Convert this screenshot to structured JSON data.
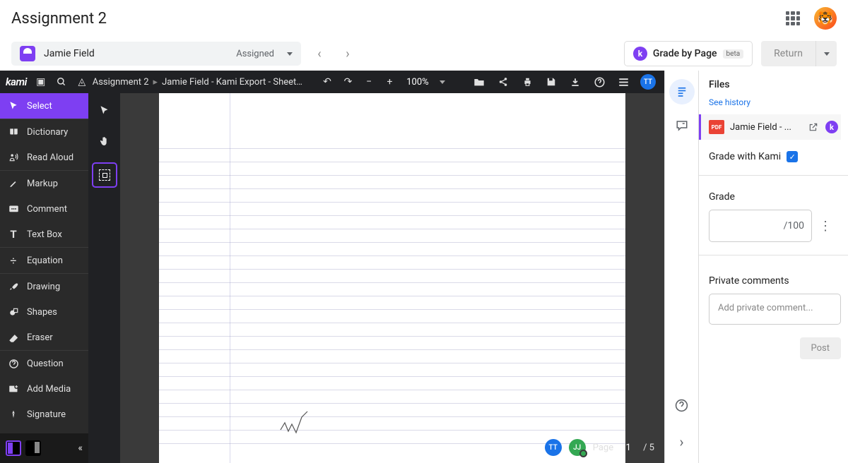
{
  "header": {
    "title": "Assignment 2"
  },
  "student": {
    "name": "Jamie Field",
    "status": "Assigned"
  },
  "actions": {
    "grade_by_page": "Grade by Page",
    "beta": "beta",
    "return": "Return"
  },
  "kami": {
    "logo": "kami",
    "breadcrumb": {
      "assignment": "Assignment 2",
      "filename": "Jamie Field - Kami Export - Sheets of pa"
    },
    "zoom": "100%",
    "avatar_tt": "TT",
    "avatar_jj": "JJ",
    "page_label": "Page",
    "page_current": "1",
    "page_total": "/ 5",
    "tools": {
      "select": "Select",
      "dictionary": "Dictionary",
      "read_aloud": "Read Aloud",
      "markup": "Markup",
      "comment": "Comment",
      "text_box": "Text Box",
      "equation": "Equation",
      "drawing": "Drawing",
      "shapes": "Shapes",
      "eraser": "Eraser",
      "question": "Question",
      "add_media": "Add Media",
      "signature": "Signature"
    }
  },
  "panel": {
    "files_title": "Files",
    "see_history": "See history",
    "file_name": "Jamie Field - ...",
    "pdf": "PDF",
    "grade_with_kami": "Grade with Kami",
    "grade_label": "Grade",
    "grade_denom": "/100",
    "pc_label": "Private comments",
    "pc_placeholder": "Add private comment...",
    "post": "Post"
  }
}
